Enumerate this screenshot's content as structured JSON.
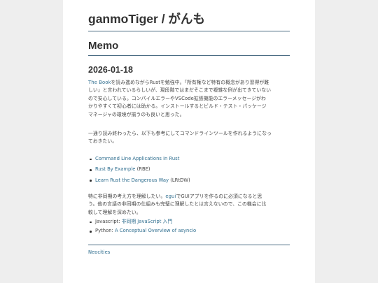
{
  "site": {
    "title": "ganmoTiger / がんも"
  },
  "page": {
    "title": "Memo"
  },
  "post": {
    "date": "2026-01-18",
    "p1": {
      "link": "The Book",
      "lines": [
        "を読み進めながらRustを勉強中。「所有権など特有の概念があり習得が難",
        "しい」と言われているらしいが、現段階ではまだそこまで複雑な例が出てきていない",
        "ので安心している。コンパイルエラーやVSCode拡張機能のエラーメッセージがわ",
        "かりやすくて初心者には助かる。インストールするとビルド・テスト・パッケージ",
        "マネージャの環境が揃うのも良いと思った。"
      ]
    },
    "p2": {
      "lines": [
        "一通り読み終わったら、以下も参考にしてコマンドラインツールを作れるようになっ",
        "ておきたい。"
      ]
    },
    "resources": [
      {
        "link": "Command Line Applications in Rust",
        "suffix": ""
      },
      {
        "link": "Rust By Example",
        "suffix": " (RBE)"
      },
      {
        "link": "Learn Rust the Dangerous Way",
        "suffix": " (LRtDW)"
      }
    ],
    "p3": {
      "pre": "特に非同期の考え方を理解したい。",
      "link": "egui",
      "post": "でGUIアプリを作るのに必須になると思",
      "lines": [
        "う。他の言語の非同期の仕組みも完璧に理解したとは言えないので、この機会に比",
        "較して理解を深めたい。"
      ]
    },
    "async_resources": [
      {
        "prefix": "Javascript: ",
        "link": "非同期 JavaScript 入門"
      },
      {
        "prefix": "Python: ",
        "link": "A Conceptual Overview of asyncio"
      }
    ]
  },
  "footer": {
    "link": "Neocities"
  },
  "colors": {
    "accent": "#2f6e8f",
    "rule": "#4a6b82",
    "background": "#eeeeee",
    "page": "#ffffff"
  }
}
